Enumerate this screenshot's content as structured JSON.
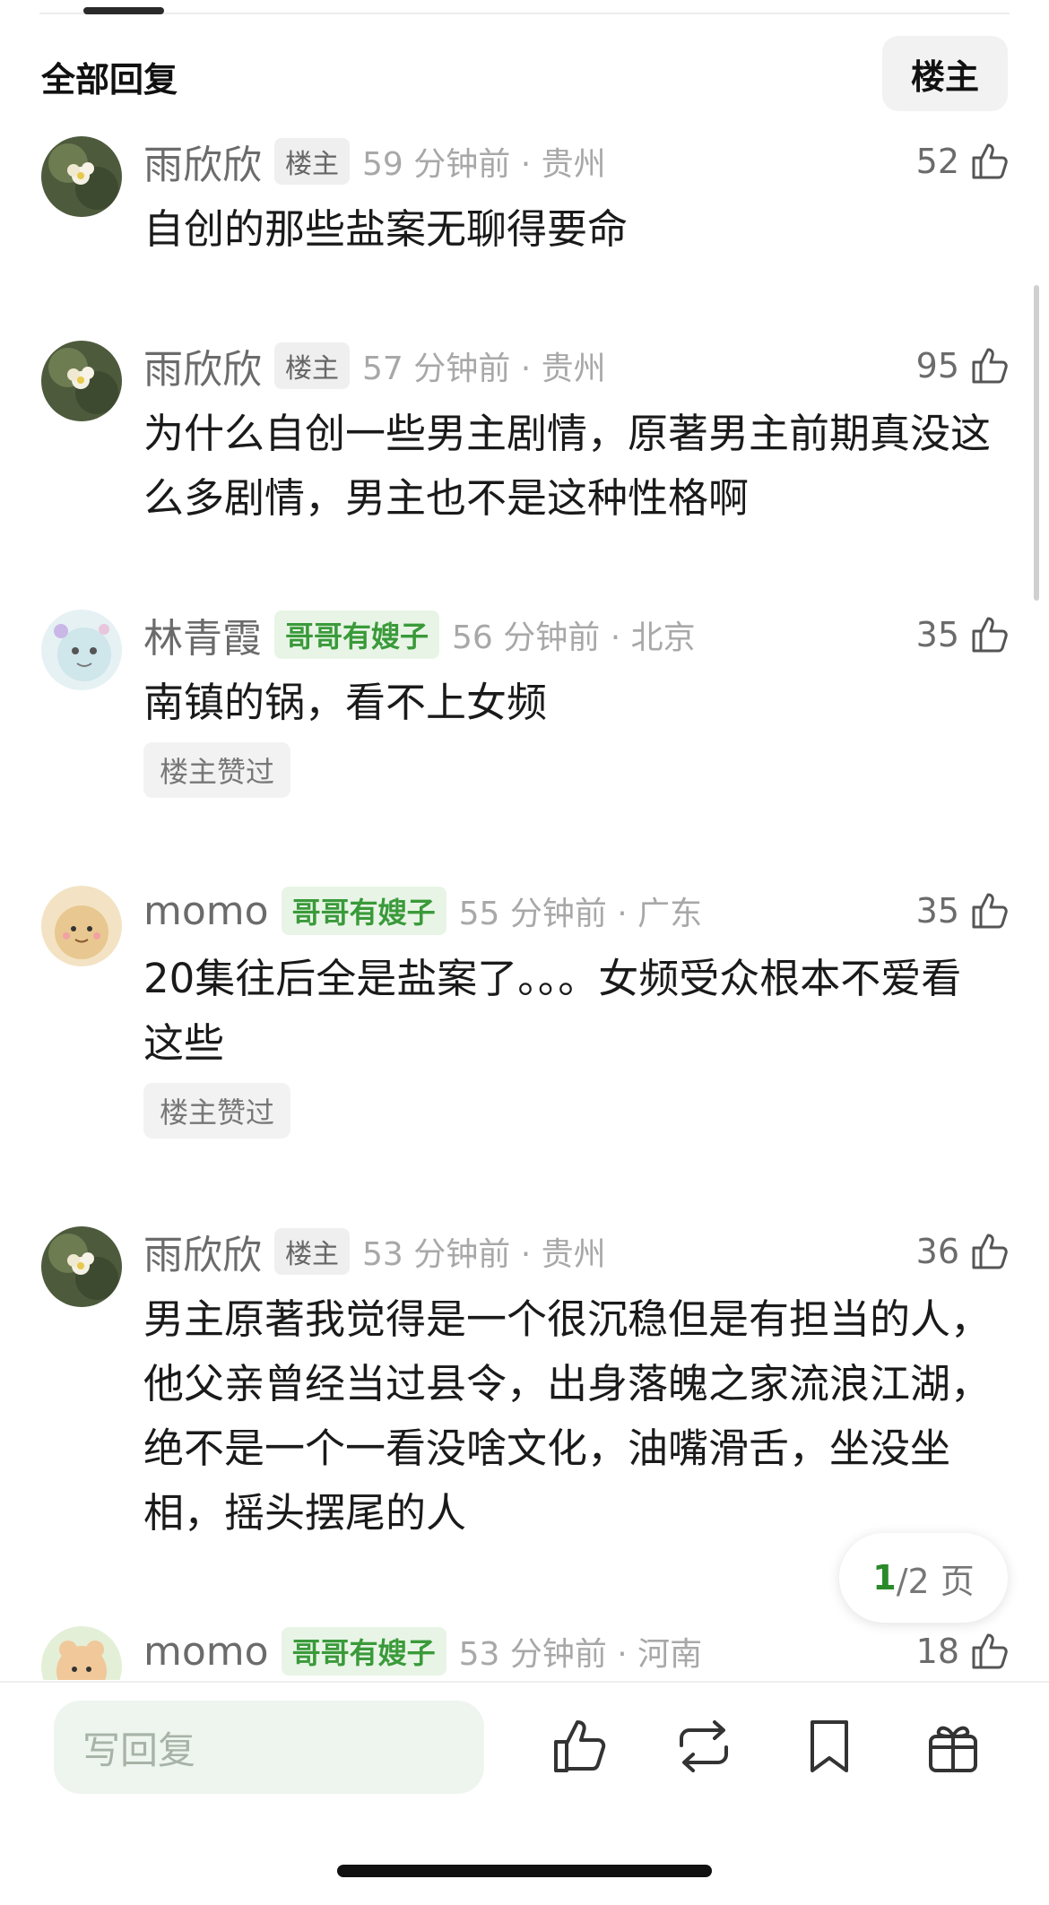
{
  "header": {
    "title": "全部回复",
    "owner_toggle": "楼主"
  },
  "comments": [
    {
      "name": "雨欣欣",
      "badge": "楼主",
      "badge_type": "owner",
      "meta": "59 分钟前 · 贵州",
      "likes": "52",
      "text": "自创的那些盐案无聊得要命",
      "liked_by_owner": ""
    },
    {
      "name": "雨欣欣",
      "badge": "楼主",
      "badge_type": "owner",
      "meta": "57 分钟前 · 贵州",
      "likes": "95",
      "text": "为什么自创一些男主剧情，原著男主前期真没这么多剧情，男主也不是这种性格啊",
      "liked_by_owner": ""
    },
    {
      "name": "林青霞",
      "badge": "哥哥有嫂子",
      "badge_type": "green",
      "meta": "56 分钟前 · 北京",
      "likes": "35",
      "text": "南镇的锅，看不上女频",
      "liked_by_owner": "楼主赞过"
    },
    {
      "name": "momo",
      "badge": "哥哥有嫂子",
      "badge_type": "green",
      "meta": "55 分钟前 · 广东",
      "likes": "35",
      "text": "20集往后全是盐案了。。。女频受众根本不爱看这些",
      "liked_by_owner": "楼主赞过"
    },
    {
      "name": "雨欣欣",
      "badge": "楼主",
      "badge_type": "owner",
      "meta": "53 分钟前 · 贵州",
      "likes": "36",
      "text": "男主原著我觉得是一个很沉稳但是有担当的人，他父亲曾经当过县令，出身落魄之家流浪江湖，绝不是一个一看没啥文化，油嘴滑舌，坐没坐相，摇头摆尾的人",
      "liked_by_owner": ""
    },
    {
      "name": "momo",
      "badge": "哥哥有嫂子",
      "badge_type": "green",
      "meta": "53 分钟前 · 河南",
      "likes": "18",
      "text": "",
      "liked_by_owner": ""
    }
  ],
  "pagination": {
    "current": "1",
    "rest": "/2 页"
  },
  "bottom_bar": {
    "reply_placeholder": "写回复",
    "icons": [
      "like-icon",
      "repost-icon",
      "bookmark-icon",
      "gift-icon"
    ]
  },
  "colors": {
    "green_badge": "#3a9a3a",
    "meta_grey": "#a8a8a8",
    "accent_green": "#2a8a2a"
  }
}
